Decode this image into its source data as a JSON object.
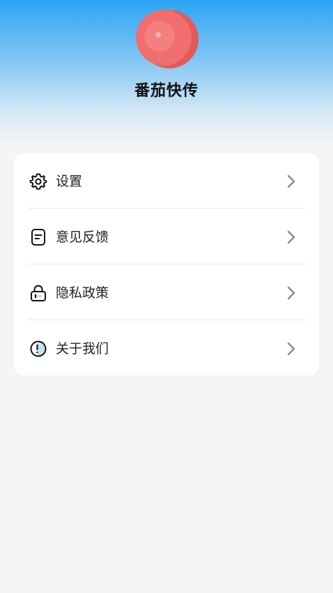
{
  "app": {
    "name": "番茄快传",
    "logo_icon": "tomato-logo-icon",
    "colors": {
      "header_top": "#2aa5f5",
      "tomato": "#ef6b6b",
      "tomato_leaf": "#5cc08a"
    }
  },
  "menu": {
    "items": [
      {
        "label": "设置",
        "icon": "gear-icon"
      },
      {
        "label": "意见反馈",
        "icon": "feedback-icon"
      },
      {
        "label": "隐私政策",
        "icon": "lock-icon"
      },
      {
        "label": "关于我们",
        "icon": "info-icon"
      }
    ]
  }
}
